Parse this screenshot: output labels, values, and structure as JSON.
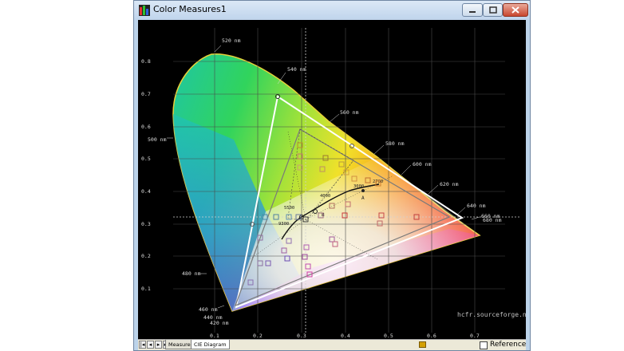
{
  "window": {
    "title": "Color Measures1",
    "minimize": "minimize",
    "maximize": "maximize",
    "close": "close"
  },
  "diagram": {
    "y_ticks": [
      "0.8",
      "0.7",
      "0.6",
      "0.5",
      "0.4",
      "0.3",
      "0.2",
      "0.1"
    ],
    "x_ticks": [
      "0.1",
      "0.2",
      "0.3",
      "0.4",
      "0.5",
      "0.6",
      "0.7"
    ],
    "wavelengths": [
      "520 nm",
      "540 nm",
      "560 nm",
      "580 nm",
      "600 nm",
      "620 nm",
      "640 nm",
      "660 nm",
      "680 nm",
      "500 nm",
      "480 nm",
      "460 nm",
      "440 nm",
      "420 nm"
    ],
    "temperatures": [
      "2700",
      "3000",
      "4000",
      "5500",
      "9300"
    ],
    "points": [
      "A",
      "B"
    ],
    "watermark": "hcfr.sourceforge.net"
  },
  "tabs": {
    "first": "|◂",
    "prev": "◂",
    "next": "▸",
    "last": "▸|",
    "measures": "Measures",
    "cie": "CIE Diagram"
  },
  "reference": {
    "label": "Reference",
    "checked": false
  }
}
